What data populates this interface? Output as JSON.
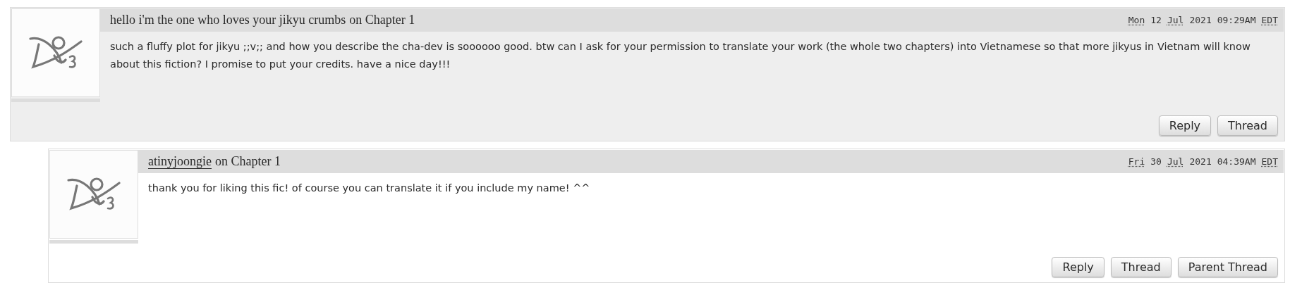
{
  "comments": [
    {
      "author": {
        "kind": "anonymous",
        "name": "hello i'm the one who loves your jikyu crumbs"
      },
      "on": "on Chapter 1",
      "datetime": {
        "weekday": "Mon",
        "day": "12",
        "month": "Jul",
        "year": "2021",
        "time": "09:29AM",
        "timezone": "EDT"
      },
      "text": "such a fluffy plot for jikyu ;;v;; and how you describe the cha-dev is soooooo good. btw can I ask for your permission to translate your work (the whole two chapters) into Vietnamese so that more jikyus in Vietnam will know about this fiction? I promise to put your credits. have a nice day!!!",
      "actions": [
        "Reply",
        "Thread"
      ],
      "children": [
        {
          "author": {
            "kind": "user",
            "name": "atinyjoongie"
          },
          "on": "on Chapter 1",
          "datetime": {
            "weekday": "Fri",
            "day": "30",
            "month": "Jul",
            "year": "2021",
            "time": "04:39AM",
            "timezone": "EDT"
          },
          "text": "thank you for liking this fic! of course you can translate it if you include my name! ^^",
          "actions": [
            "Reply",
            "Thread",
            "Parent Thread"
          ]
        }
      ]
    }
  ]
}
